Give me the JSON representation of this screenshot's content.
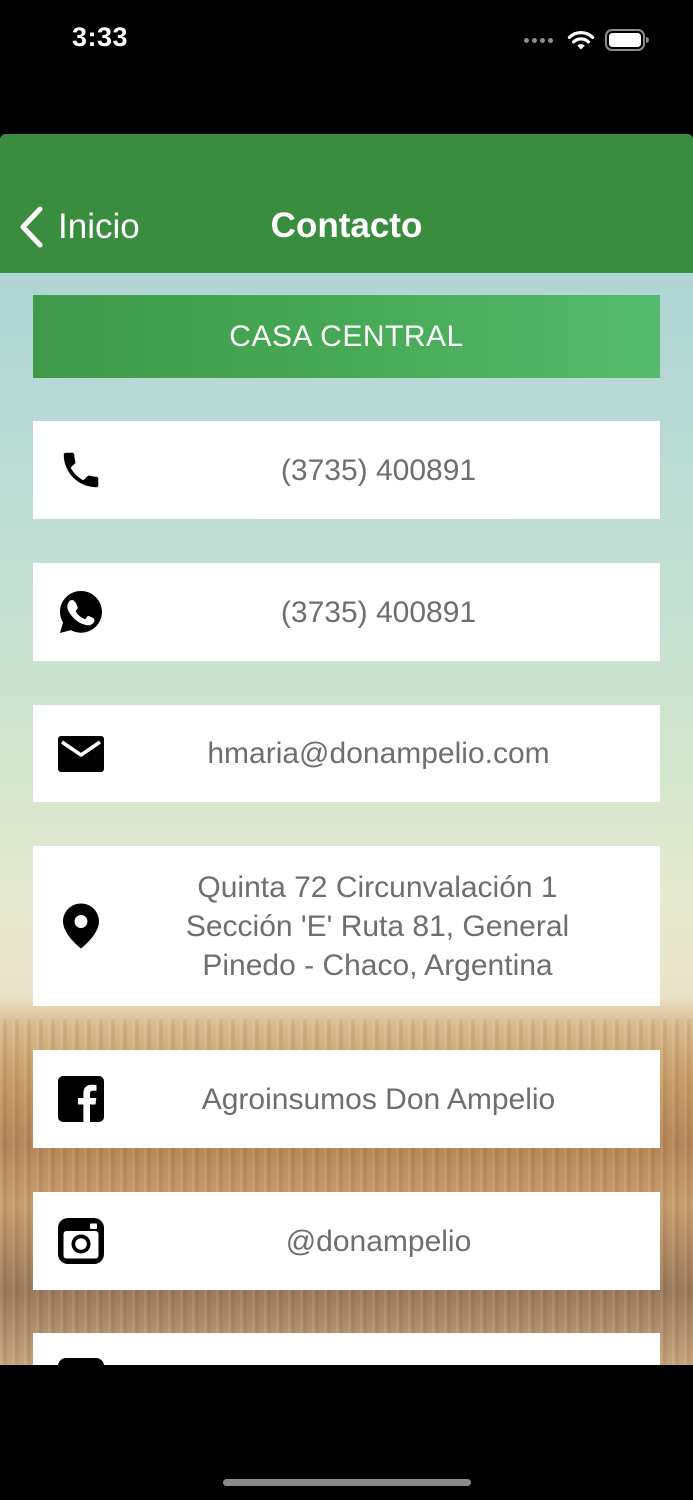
{
  "status_bar": {
    "time": "3:33"
  },
  "nav": {
    "back_label": "Inicio",
    "title": "Contacto"
  },
  "section": {
    "title": "CASA CENTRAL"
  },
  "contacts": {
    "phone": {
      "icon": "phone-icon",
      "text": "(3735) 400891"
    },
    "whatsapp": {
      "icon": "whatsapp-icon",
      "text": "(3735) 400891"
    },
    "email": {
      "icon": "mail-icon",
      "text": "hmaria@donampelio.com"
    },
    "address": {
      "icon": "location-pin-icon",
      "text": "Quinta 72 Circunvalación 1 Sección 'E' Ruta 81, General Pinedo - Chaco, Argentina"
    },
    "facebook": {
      "icon": "facebook-icon",
      "text": "Agroinsumos Don Ampelio"
    },
    "instagram": {
      "icon": "instagram-icon",
      "text": "@donampelio"
    }
  },
  "colors": {
    "nav_green": "#3a8d3f",
    "header_green": "#46a955",
    "card_text": "#6e6e6e"
  }
}
